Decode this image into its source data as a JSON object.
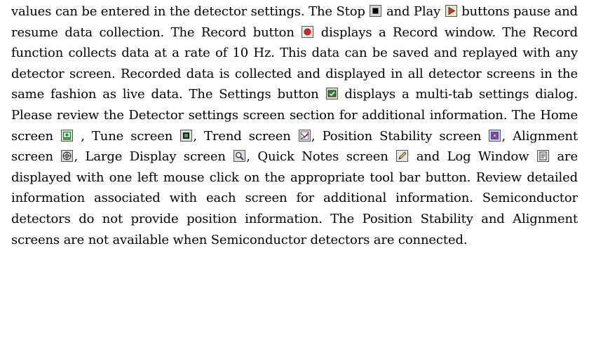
{
  "segments": [
    {
      "text": "values can be entered in the detector settings. The Stop "
    },
    {
      "icon": "stop-icon"
    },
    {
      "text": " and Play "
    },
    {
      "icon": "play-icon"
    },
    {
      "text": " buttons pause and resume data collection. The Record button "
    },
    {
      "icon": "record-icon"
    },
    {
      "text": " displays a Record window. The Record function collects data at a rate of 10 Hz. This data can be saved and replayed with any detector screen. Recorded data is collected and displayed in all detector screens in the same fashion as live data. The Settings button "
    },
    {
      "icon": "settings-icon"
    },
    {
      "text": " displays a multi-tab settings dialog. Please review the Detector settings screen section for additional informa­tion. The Home screen "
    },
    {
      "icon": "home-screen-icon"
    },
    {
      "text": " , Tune screen "
    },
    {
      "icon": "tune-screen-icon"
    },
    {
      "text": ", Trend screen "
    },
    {
      "icon": "trend-screen-icon"
    },
    {
      "text": ", Position Stability screen "
    },
    {
      "icon": "position-stability-icon"
    },
    {
      "text": ", Alignment screen "
    },
    {
      "icon": "alignment-screen-icon"
    },
    {
      "text": ", Large Display screen "
    },
    {
      "icon": "large-display-icon"
    },
    {
      "text": ", Quick Notes screen "
    },
    {
      "icon": "quick-notes-icon"
    },
    {
      "text": " and Log Window "
    },
    {
      "icon": "log-window-icon"
    },
    {
      "text": " are displayed with one left mouse click on the appropriate tool bar button. Review detailed information associated with each screen for additional information. Semiconductor detectors do not provide position information. The Position Stability and Alignment screens are not available when Semiconductor detectors are connected."
    }
  ]
}
